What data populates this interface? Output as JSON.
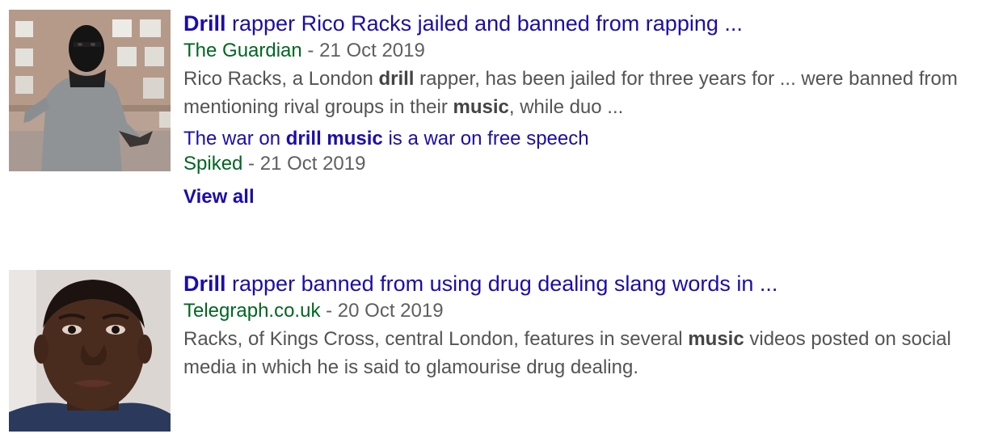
{
  "results": [
    {
      "title_bold": "Drill",
      "title_rest": " rapper Rico Racks jailed and banned from rapping ...",
      "source": "The Guardian",
      "separator": " - ",
      "date": "21 Oct 2019",
      "snippet": [
        {
          "text": "Rico Racks, a London ",
          "bold": false
        },
        {
          "text": "drill",
          "bold": true
        },
        {
          "text": " rapper, has been jailed for three years for ... were banned from mentioning rival groups in their ",
          "bold": false
        },
        {
          "text": "music",
          "bold": true
        },
        {
          "text": ", while duo ...",
          "bold": false
        }
      ],
      "related": {
        "title": [
          {
            "text": "The war on ",
            "bold": false
          },
          {
            "text": "drill music",
            "bold": true
          },
          {
            "text": " is a war on free speech",
            "bold": false
          }
        ],
        "source": "Spiked",
        "separator": " - ",
        "date": "21 Oct 2019"
      },
      "view_all_label": "View all"
    },
    {
      "title_bold": "Drill",
      "title_rest": " rapper banned from using drug dealing slang words in ...",
      "source": "Telegraph.co.uk",
      "separator": " - ",
      "date": "20 Oct 2019",
      "snippet": [
        {
          "text": "Racks, of Kings Cross, central London, features in several ",
          "bold": false
        },
        {
          "text": "music",
          "bold": true
        },
        {
          "text": " videos posted on social media in which he is said to glamourise drug dealing.",
          "bold": false
        }
      ]
    }
  ],
  "colors": {
    "link": "#1a0dab",
    "source": "#006621",
    "meta": "#5f5f5f",
    "snippet": "#545454"
  }
}
